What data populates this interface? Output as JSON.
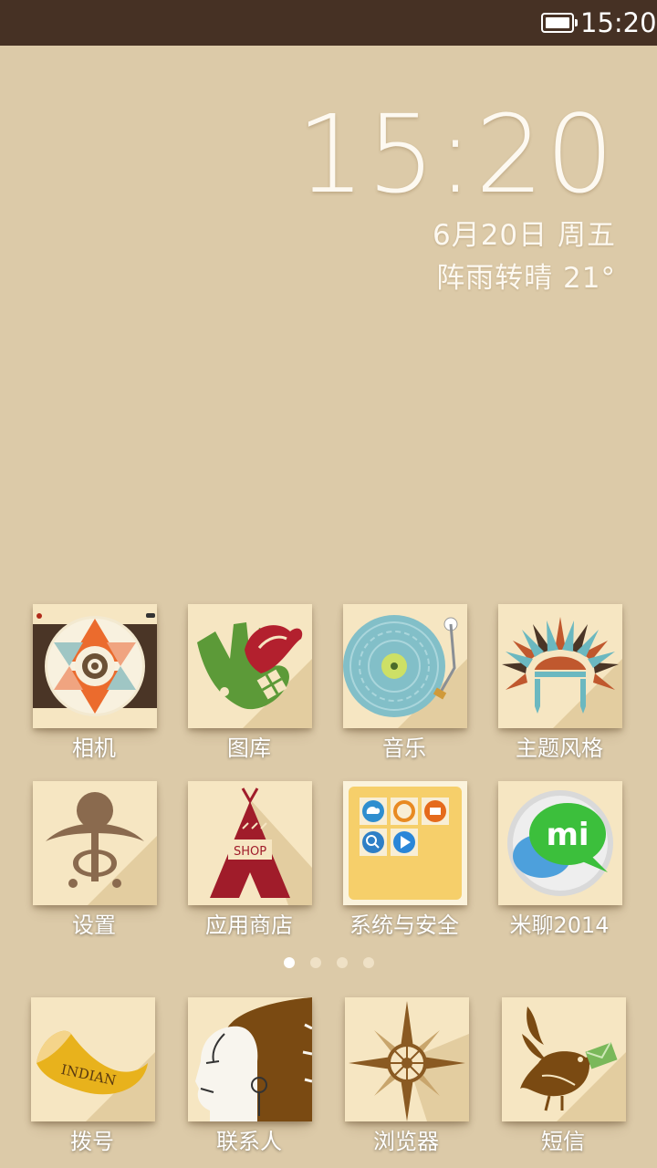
{
  "status_bar": {
    "time": "15:20",
    "battery_icon": "battery-full-icon"
  },
  "clock_widget": {
    "time": "15:20",
    "date": "6月20日 周五",
    "weather": "阵雨转晴  21°"
  },
  "page_indicator": {
    "pages": 4,
    "current": 1
  },
  "apps": [
    {
      "label": "相机",
      "icon": "camera-icon"
    },
    {
      "label": "图库",
      "icon": "gallery-icon"
    },
    {
      "label": "音乐",
      "icon": "music-icon"
    },
    {
      "label": "主题风格",
      "icon": "theme-icon"
    },
    {
      "label": "设置",
      "icon": "settings-icon"
    },
    {
      "label": "应用商店",
      "icon": "app-store-icon",
      "icon_text": "SHOP"
    },
    {
      "label": "系统与安全",
      "icon": "system-security-icon"
    },
    {
      "label": "米聊2014",
      "icon": "miliao-icon",
      "icon_text": "mi"
    }
  ],
  "dock": [
    {
      "label": "拨号",
      "icon": "dialer-icon",
      "icon_text": "INDIAN"
    },
    {
      "label": "联系人",
      "icon": "contacts-icon"
    },
    {
      "label": "浏览器",
      "icon": "browser-icon"
    },
    {
      "label": "短信",
      "icon": "messages-icon"
    }
  ],
  "colors": {
    "status_bar": "#463124",
    "wallpaper": "#dccaa8",
    "tile": "#f6e6c2"
  }
}
